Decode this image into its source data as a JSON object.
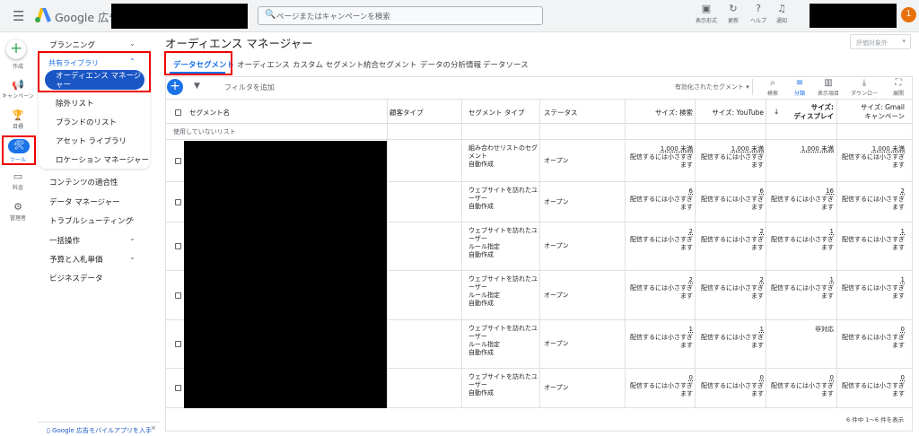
{
  "header": {
    "brand": "Google 広告",
    "search_placeholder": "ページまたはキャンペーンを検索",
    "tools": [
      {
        "icon": "appearance-icon",
        "label": "表示形式"
      },
      {
        "icon": "refresh-icon",
        "label": "更新"
      },
      {
        "icon": "help-icon",
        "label": "ヘルプ"
      },
      {
        "icon": "bell-icon",
        "label": "通知"
      }
    ],
    "avatar": "1"
  },
  "rail": [
    {
      "icon": "plus-icon",
      "label": "作成"
    },
    {
      "icon": "megaphone-icon",
      "label": "キャンペーン"
    },
    {
      "icon": "trophy-icon",
      "label": "目標"
    },
    {
      "icon": "wrench-icon",
      "label": "ツール"
    },
    {
      "icon": "billing-icon",
      "label": "料金"
    },
    {
      "icon": "gear-icon",
      "label": "管理者"
    }
  ],
  "nav": {
    "planning": "プランニング",
    "shared_library": "共有ライブラリ",
    "audience_manager": "オーディエンス マネージャー",
    "exclusion_list": "除外リスト",
    "brand_list": "ブランドのリスト",
    "asset_library": "アセット ライブラリ",
    "location_manager": "ロケーション マネージャー",
    "content_suitability": "コンテンツの適合性",
    "data_manager": "データ マネージャー",
    "troubleshooting": "トラブルシューティング",
    "bulk_actions": "一括操作",
    "budgets_bidding": "予算と入札単価",
    "business_data": "ビジネスデータ",
    "mobile_app": "Google 広告モバイルアプリを入手"
  },
  "page": {
    "title": "オーディエンス マネージャー",
    "eval_button": "評価対象外"
  },
  "tabs": [
    "データセグメント",
    "オーディエンス",
    "カスタム セグメント",
    "統合セグメント",
    "データの分析情報",
    "データソース"
  ],
  "toolbar": {
    "add_filter": "フィルタを追加",
    "enabled_segments": "有効化されたセグメント",
    "buttons": [
      {
        "icon": "search-icon",
        "label": "検索"
      },
      {
        "icon": "segment-icon",
        "label": "分類"
      },
      {
        "icon": "columns-icon",
        "label": "表示項目"
      },
      {
        "icon": "download-icon",
        "label": "ダウンロード"
      },
      {
        "icon": "expand-icon",
        "label": "展開"
      }
    ]
  },
  "table": {
    "headers": {
      "segment_name": "セグメント名",
      "customer_type": "顧客タイプ",
      "segment_type": "セグメント タイプ",
      "status": "ステータス",
      "size_search": "サイズ: 検索",
      "size_youtube": "サイズ: YouTube",
      "size_display_1": "サイズ:",
      "size_display_2": "ディスプレイ",
      "size_gmail_1": "サイズ: Gmail",
      "size_gmail_2": "キャンペーン"
    },
    "group_label": "使用していないリスト",
    "rows": [
      {
        "type": [
          "組み合わせリストのセグ",
          "メント",
          "自動作成"
        ],
        "status": "オープン",
        "search": [
          "1,000 未満",
          "配信するには小さすぎ",
          "ます"
        ],
        "youtube": [
          "1,000 未満",
          "配信するには小さすぎ",
          "ます"
        ],
        "display": [
          "1,000 未満"
        ],
        "gmail": [
          "1,000 未満",
          "配信するには小さすぎ",
          "ます"
        ]
      },
      {
        "type": [
          "ウェブサイトを訪れたユ",
          "ーザー",
          "自動作成"
        ],
        "status": "オープン",
        "search": [
          "6",
          "配信するには小さすぎ",
          "ます"
        ],
        "youtube": [
          "6",
          "配信するには小さすぎ",
          "ます"
        ],
        "display": [
          "16",
          "配信するには小さすぎ",
          "ます"
        ],
        "gmail": [
          "2",
          "配信するには小さすぎ",
          "ます"
        ]
      },
      {
        "type": [
          "ウェブサイトを訪れたユ",
          "ーザー",
          "ルール指定",
          "自動作成"
        ],
        "status": "オープン",
        "search": [
          "2",
          "配信するには小さすぎ",
          "ます"
        ],
        "youtube": [
          "2",
          "配信するには小さすぎ",
          "ます"
        ],
        "display": [
          "1",
          "配信するには小さすぎ",
          "ます"
        ],
        "gmail": [
          "1",
          "配信するには小さすぎ",
          "ます"
        ]
      },
      {
        "type": [
          "ウェブサイトを訪れたユ",
          "ーザー",
          "ルール指定",
          "自動作成"
        ],
        "status": "オープン",
        "search": [
          "2",
          "配信するには小さすぎ",
          "ます"
        ],
        "youtube": [
          "2",
          "配信するには小さすぎ",
          "ます"
        ],
        "display": [
          "1",
          "配信するには小さすぎ",
          "ます"
        ],
        "gmail": [
          "1",
          "配信するには小さすぎ",
          "ます"
        ]
      },
      {
        "type": [
          "ウェブサイトを訪れたユ",
          "ーザー",
          "ルール指定",
          "自動作成"
        ],
        "status": "オープン",
        "search": [
          "1",
          "配信するには小さすぎ",
          "ます"
        ],
        "youtube": [
          "1",
          "配信するには小さすぎ",
          "ます"
        ],
        "display": [
          "",
          "非対応"
        ],
        "gmail": [
          "0",
          "配信するには小さすぎ",
          "ます"
        ]
      },
      {
        "type": [
          "ウェブサイトを訪れたユ",
          "ーザー",
          "自動作成"
        ],
        "status": "オープン",
        "search": [
          "0",
          "配信するには小さすぎ",
          "ます"
        ],
        "youtube": [
          "0",
          "配信するには小さすぎ",
          "ます"
        ],
        "display": [
          "0",
          "配信するには小さすぎ",
          "ます"
        ],
        "gmail": [
          "0",
          "配信するには小さすぎ",
          "ます"
        ]
      }
    ]
  },
  "pagination": "6 件中 1～6 件を表示",
  "colors": {
    "accent": "#1a73e8",
    "highlight": "#ee0000",
    "selected": "#1a56c4"
  }
}
